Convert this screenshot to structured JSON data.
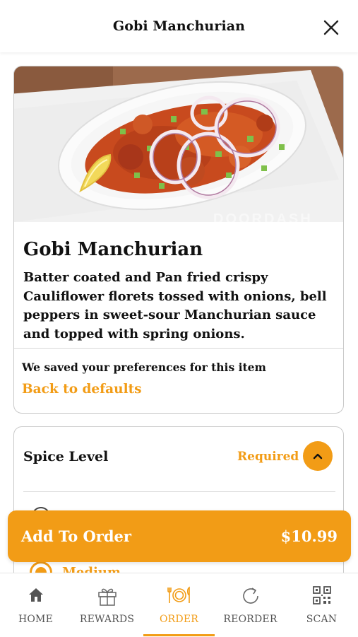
{
  "header": {
    "title": "Gobi Manchurian"
  },
  "item": {
    "title": "Gobi Manchurian",
    "description": "Batter coated and Pan fried crispy Cauliflower florets tossed with onions, bell peppers in sweet-sour Manchurian sauce and topped with spring onions.",
    "image_watermark": "DOORDASH",
    "preferences_note": "We saved your preferences for this item",
    "back_to_defaults": "Back to defaults"
  },
  "spice": {
    "label": "Spice Level",
    "required": "Required",
    "selected_option": "Medium"
  },
  "add_to_order": {
    "label": "Add To Order",
    "price": "$10.99"
  },
  "tabs": [
    {
      "label": "HOME",
      "icon": "home-icon",
      "active": false
    },
    {
      "label": "REWARDS",
      "icon": "gift-icon",
      "active": false
    },
    {
      "label": "ORDER",
      "icon": "plate-utensils-icon",
      "active": true
    },
    {
      "label": "REORDER",
      "icon": "refresh-icon",
      "active": false
    },
    {
      "label": "SCAN",
      "icon": "qr-code-icon",
      "active": false
    }
  ],
  "colors": {
    "accent": "#f29c16",
    "text": "#111111",
    "border": "#c9c9c9"
  }
}
